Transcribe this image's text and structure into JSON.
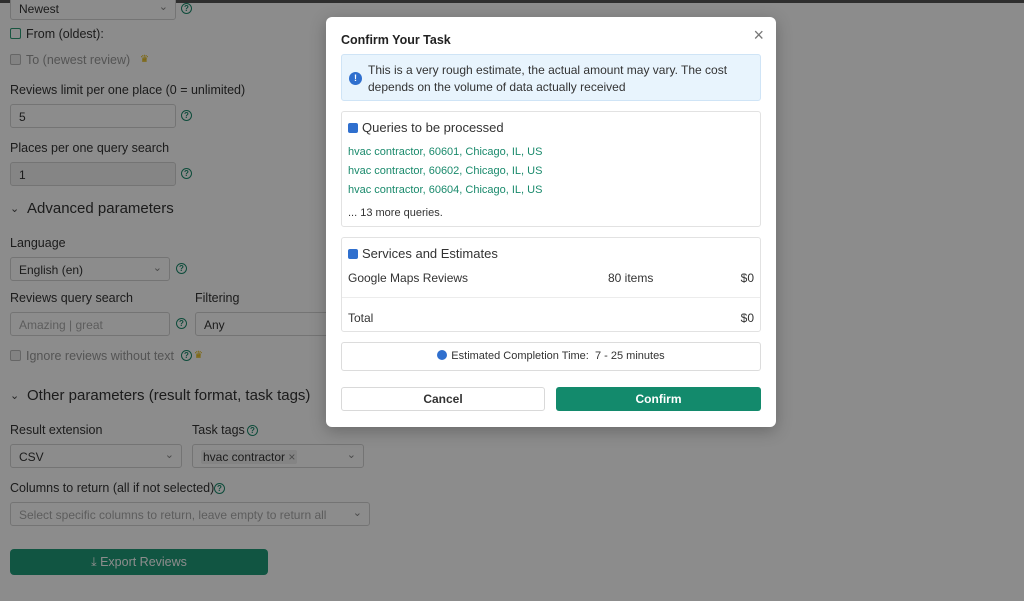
{
  "form": {
    "sort_value": "Newest",
    "from_label": "From (oldest):",
    "to_label": "To (newest review)",
    "reviews_limit_label": "Reviews limit per one place (0 = unlimited)",
    "reviews_limit_value": "5",
    "places_per_query_label": "Places per one query search",
    "places_per_query_value": "1",
    "advanced_label": "Advanced parameters",
    "language_label": "Language",
    "language_value": "English (en)",
    "reviews_query_label": "Reviews query search",
    "reviews_query_placeholder": "Amazing | great",
    "filtering_label": "Filtering",
    "filtering_value": "Any",
    "ignore_label": "Ignore reviews without text",
    "other_label": "Other parameters (result format, task tags)",
    "result_ext_label": "Result extension",
    "result_ext_value": "CSV",
    "task_tags_label": "Task tags",
    "task_tag_value": "hvac contractor",
    "columns_label": "Columns to return (all if not selected)",
    "columns_placeholder": "Select specific columns to return, leave empty to return all",
    "export_label": "Export Reviews"
  },
  "modal": {
    "title": "Confirm Your Task",
    "info_line1": "This is a very rough estimate, the actual amount may vary. The cost",
    "info_line2": "depends on the volume of data actually received",
    "queries_title": "Queries to be processed",
    "queries": [
      "hvac contractor, 60601, Chicago, IL, US",
      "hvac contractor, 60602, Chicago, IL, US",
      "hvac contractor, 60604, Chicago, IL, US"
    ],
    "more_queries": "... 13 more queries.",
    "services_title": "Services and Estimates",
    "service_name": "Google Maps Reviews",
    "service_items": "80 items",
    "service_cost": "$0",
    "total_label": "Total",
    "total_cost": "$0",
    "estimated_label": "Estimated Completion Time:",
    "estimated_value": "7 - 25 minutes",
    "cancel_label": "Cancel",
    "confirm_label": "Confirm"
  },
  "colors": {
    "accent": "#138a6c",
    "info_bg": "#e8f4fd",
    "link": "#1a8a6c",
    "icon_blue": "#2f6fce"
  }
}
